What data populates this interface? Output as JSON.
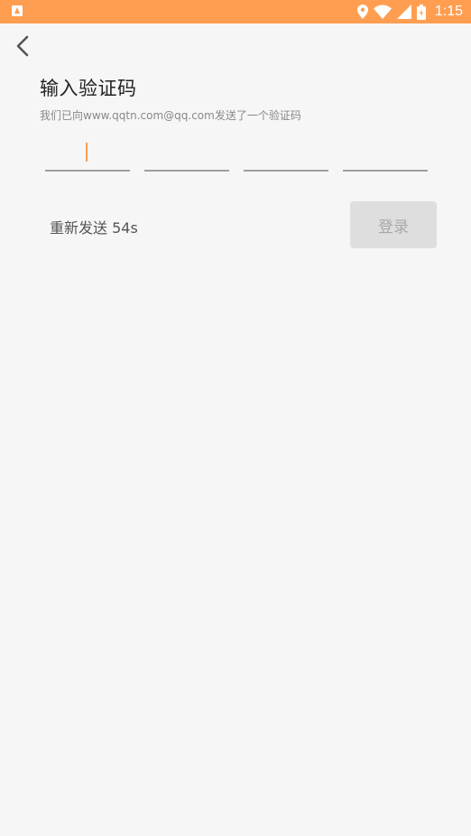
{
  "status_bar": {
    "time": "1:15",
    "color": "#ff9e50",
    "icons": [
      "app-icon",
      "location-icon",
      "wifi-icon",
      "cell-signal-icon",
      "battery-icon"
    ]
  },
  "header": {
    "back_icon": "chevron-left-icon"
  },
  "main": {
    "title": "输入验证码",
    "subtitle": "我们已向www.qqtn.com@qq.com发送了一个验证码",
    "code_inputs": [
      "",
      "",
      "",
      ""
    ],
    "resend_text": "重新发送 54s",
    "login_label": "登录"
  },
  "colors": {
    "accent": "#ff9e50",
    "background": "#f6f6f6",
    "button_disabled": "#dedede"
  }
}
